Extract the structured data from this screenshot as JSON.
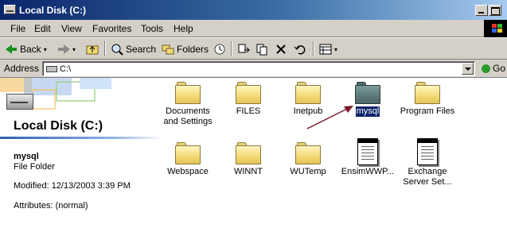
{
  "window": {
    "title": "Local Disk (C:)"
  },
  "menu": [
    "File",
    "Edit",
    "View",
    "Favorites",
    "Tools",
    "Help"
  ],
  "toolbar": {
    "back_label": "Back",
    "search_label": "Search",
    "folders_label": "Folders",
    "icons": [
      "back-arrow-icon",
      "forward-arrow-icon",
      "up-folder-icon",
      "search-icon",
      "folders-icon",
      "history-icon",
      "move-to-icon",
      "copy-to-icon",
      "delete-icon",
      "undo-icon",
      "views-icon"
    ]
  },
  "address": {
    "label": "Address",
    "value": "C:\\",
    "go_label": "Go"
  },
  "left_panel": {
    "banner_title": "Local Disk (C:)",
    "selected_name": "mysql",
    "selected_type": "File Folder",
    "modified": "Modified: 12/13/2003 3:39 PM",
    "attributes": "Attributes: (normal)"
  },
  "items": [
    {
      "label": "Documents\nand Settings",
      "kind": "folder",
      "selected": false
    },
    {
      "label": "FILES",
      "kind": "folder",
      "selected": false
    },
    {
      "label": "Inetpub",
      "kind": "folder",
      "selected": false
    },
    {
      "label": "mysql",
      "kind": "folder",
      "selected": true
    },
    {
      "label": "Program Files",
      "kind": "folder",
      "selected": false
    },
    {
      "label": "Webspace",
      "kind": "folder",
      "selected": false
    },
    {
      "label": "WINNT",
      "kind": "folder",
      "selected": false
    },
    {
      "label": "WUTemp",
      "kind": "folder",
      "selected": false
    },
    {
      "label": "EnsimWWP...",
      "kind": "file",
      "selected": false
    },
    {
      "label": "Exchange\nServer Set...",
      "kind": "file",
      "selected": false
    }
  ],
  "colors": {
    "title_start": "#0a246a",
    "title_end": "#a6caf0",
    "selection": "#0a246a",
    "annotation_arrow": "#7a1a2a"
  }
}
